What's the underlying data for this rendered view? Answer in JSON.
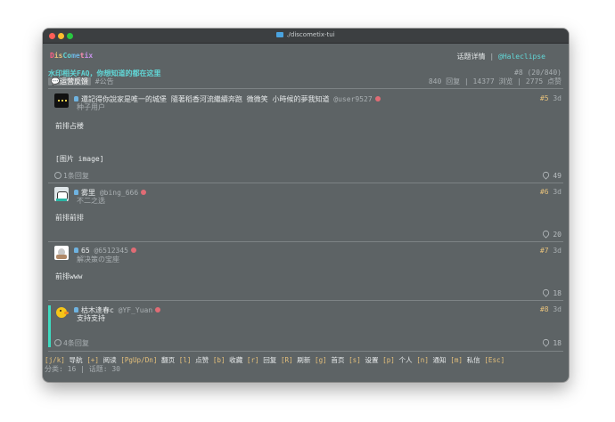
{
  "window": {
    "title": "./discometix-tui"
  },
  "header": {
    "brand": [
      "D",
      "is",
      "Co",
      "me",
      "t",
      "ix"
    ],
    "brand_colors": [
      "#ff5f87",
      "#e5c07b",
      "#61d6d6",
      "#6fb3e0",
      "#ff8fb3",
      "#c792ea"
    ],
    "view_label": "话题详情",
    "separator": "|",
    "username": "@Haleclipse"
  },
  "topic": {
    "title": "水印相关FAQ，你想知道的都在这里",
    "category": "运营反馈",
    "tag": "#公告",
    "position": "#8 (20/840)",
    "stats": "840 回复 | 14377 浏览 | 2775 点赞"
  },
  "posts": [
    {
      "name": "還記得你說家是唯一的城堡 隨著稻香河流繼續奔跑 微微笑 小時候的夢我知道",
      "handle": "@user9527",
      "subtitle": "种子用户",
      "number": "#5",
      "age": "3d",
      "body": "前排占楼",
      "image_text": "[图片 image]",
      "replies": "1条回复",
      "likes": "49"
    },
    {
      "name": "雾里",
      "handle": "@bing_666",
      "subtitle": "不二之选",
      "number": "#6",
      "age": "3d",
      "body": "前排前排",
      "likes": "20"
    },
    {
      "name": "65",
      "handle": "@6512345",
      "subtitle": "解决策の宝座",
      "number": "#7",
      "age": "3d",
      "body": "前排www",
      "likes": "18"
    },
    {
      "name": "枯木逢春c",
      "handle": "@YF_Yuan",
      "body": "支持支持",
      "number": "#8",
      "age": "3d",
      "replies": "4条回复",
      "likes": "18"
    }
  ],
  "footer": {
    "shortcuts": [
      {
        "key": "[j/k]",
        "label": "导航"
      },
      {
        "key": "[+]",
        "label": "阅读"
      },
      {
        "key": "[PgUp/Dn]",
        "label": "翻页"
      },
      {
        "key": "[l]",
        "label": "点赞"
      },
      {
        "key": "[b]",
        "label": "收藏"
      },
      {
        "key": "[r]",
        "label": "回复"
      },
      {
        "key": "[R]",
        "label": "刷新"
      },
      {
        "key": "[g]",
        "label": "首页"
      },
      {
        "key": "[s]",
        "label": "设置"
      },
      {
        "key": "[p]",
        "label": "个人"
      },
      {
        "key": "[n]",
        "label": "通知"
      },
      {
        "key": "[m]",
        "label": "私信"
      },
      {
        "key": "[Esc]",
        "label": ""
      }
    ],
    "status": "分类: 16 | 话题: 30"
  }
}
